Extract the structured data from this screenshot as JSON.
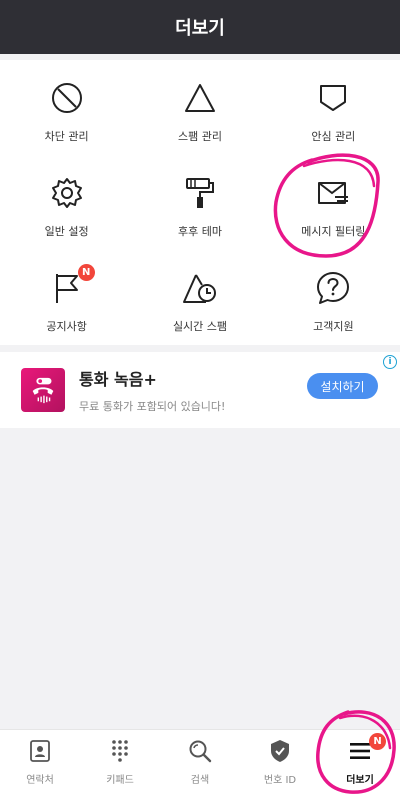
{
  "header": {
    "title": "더보기"
  },
  "menu": [
    {
      "label": "차단 관리",
      "icon": "block-icon"
    },
    {
      "label": "스팸 관리",
      "icon": "triangle-icon"
    },
    {
      "label": "안심 관리",
      "icon": "shield-flag-icon"
    },
    {
      "label": "일반 설정",
      "icon": "gear-icon"
    },
    {
      "label": "후후 테마",
      "icon": "paint-roller-icon"
    },
    {
      "label": "메시지 필터링",
      "icon": "mail-filter-icon"
    },
    {
      "label": "공지사항",
      "icon": "flag-icon",
      "badge": "N"
    },
    {
      "label": "실시간 스팸",
      "icon": "alarm-triangle-icon"
    },
    {
      "label": "고객지원",
      "icon": "help-icon"
    }
  ],
  "ad": {
    "title": "통화 녹음+",
    "subtitle": "무료 통화가 포함되어 있습니다!",
    "button": "설치하기",
    "info": "i",
    "icon": "call-record-icon",
    "icon_color": "#e9187a"
  },
  "tabs": [
    {
      "label": "연락처",
      "icon": "contacts-icon"
    },
    {
      "label": "키패드",
      "icon": "keypad-icon"
    },
    {
      "label": "검색",
      "icon": "search-icon"
    },
    {
      "label": "번호 ID",
      "icon": "shield-check-icon"
    },
    {
      "label": "더보기",
      "icon": "menu-icon",
      "badge": "N",
      "active": true
    }
  ],
  "colors": {
    "header_bg": "#2f2f35",
    "accent": "#4a8ff0",
    "badge": "#f2463b",
    "highlight": "#e8168a"
  }
}
